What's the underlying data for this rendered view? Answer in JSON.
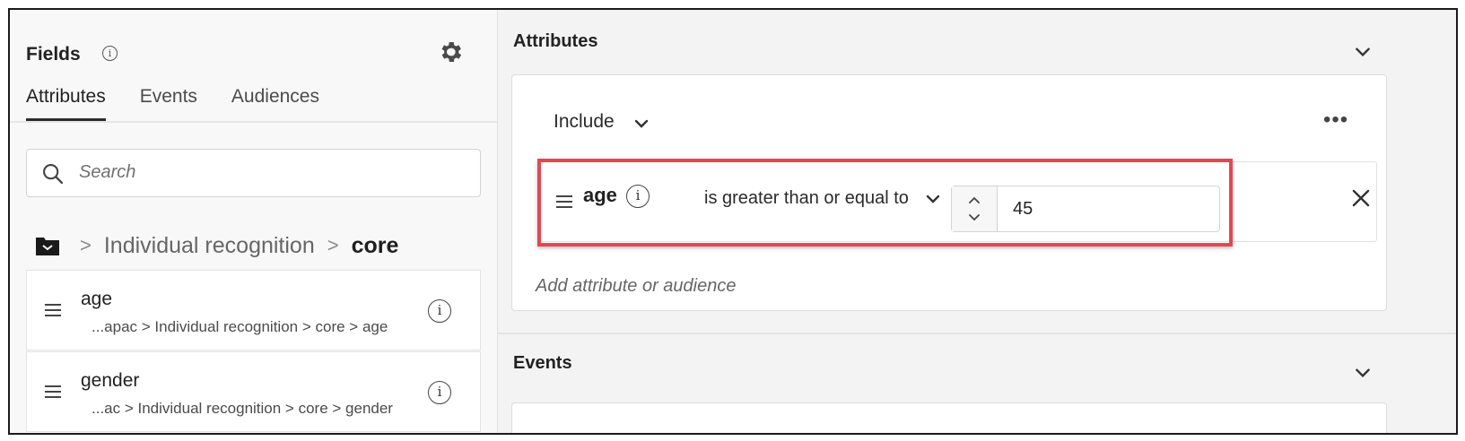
{
  "fields_panel": {
    "title": "Fields",
    "info_glyph": "i",
    "tabs": [
      {
        "label": "Attributes",
        "active": true
      },
      {
        "label": "Events",
        "active": false
      },
      {
        "label": "Audiences",
        "active": false
      }
    ],
    "search": {
      "placeholder": "Search"
    },
    "breadcrumb": {
      "separator": ">",
      "items": [
        "Individual recognition",
        "core"
      ]
    },
    "items": [
      {
        "name": "age",
        "path": "...apac > Individual recognition > core > age"
      },
      {
        "name": "gender",
        "path": "...ac > Individual recognition > core > gender"
      }
    ]
  },
  "attributes_section": {
    "title": "Attributes",
    "include_label": "Include",
    "more_glyph": "•••",
    "rule": {
      "field": "age",
      "operator": "is greater than or equal to",
      "value": "45"
    },
    "add_label": "Add attribute or audience"
  },
  "events_section": {
    "title": "Events"
  },
  "colors": {
    "highlight": "#e34850"
  }
}
